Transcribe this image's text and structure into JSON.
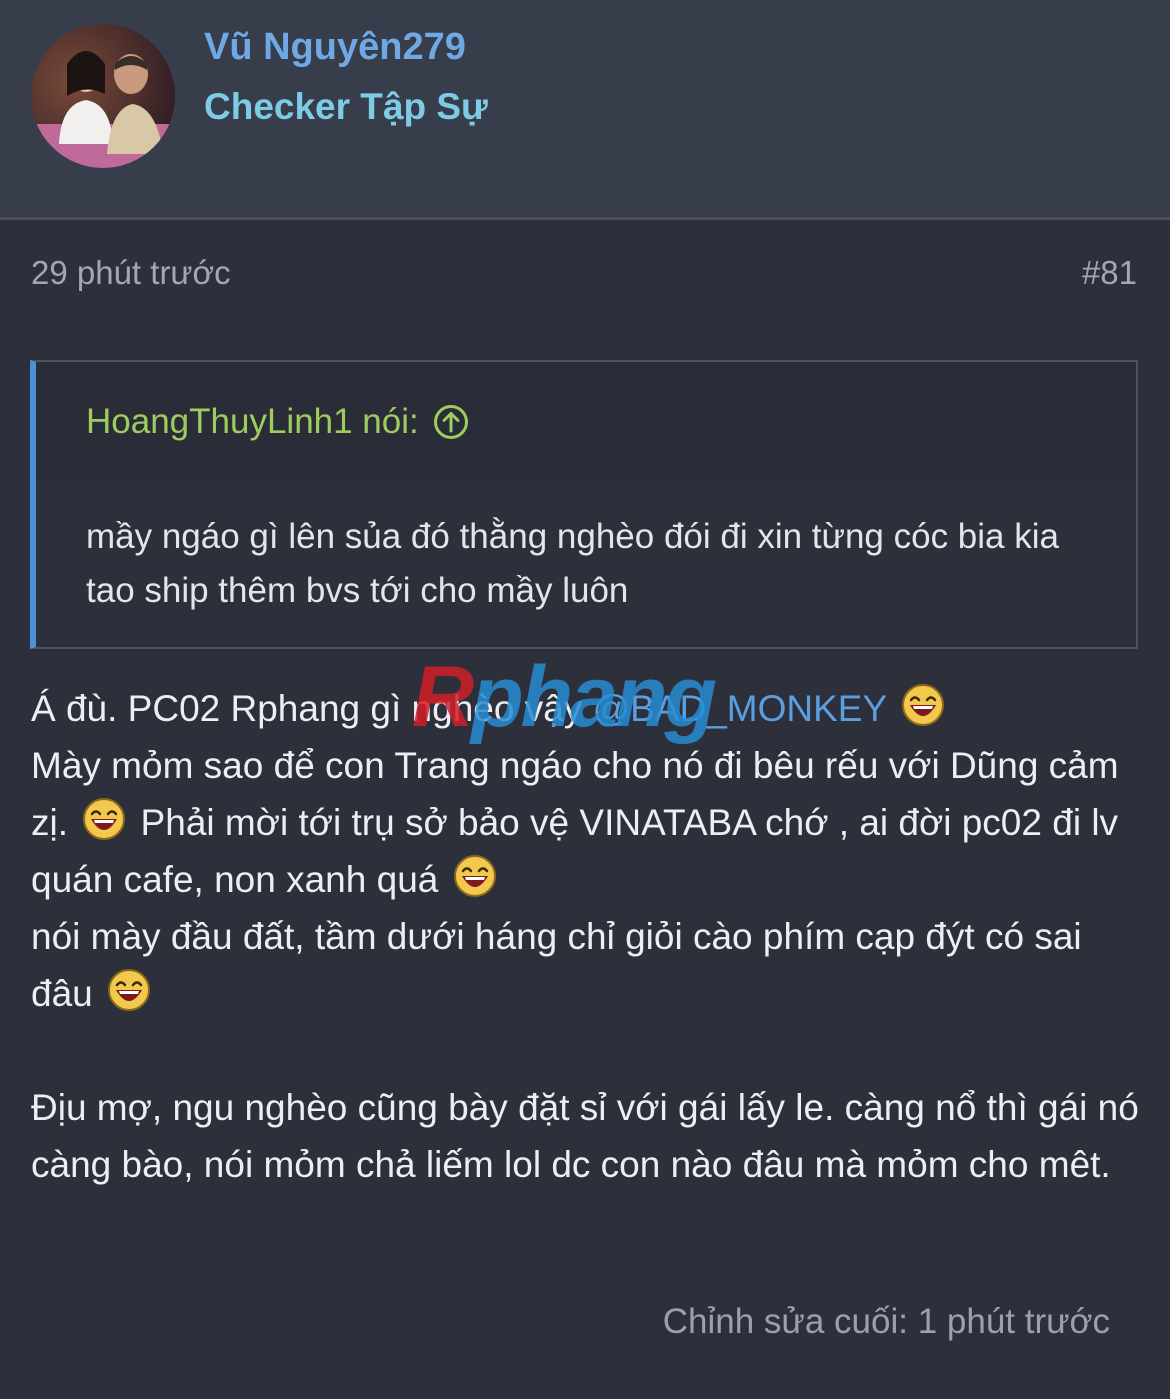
{
  "user": {
    "name": "Vũ Nguyên279",
    "title": "Checker Tập Sự"
  },
  "post": {
    "time": "29 phút trước",
    "number": "#81",
    "edited": "Chỉnh sửa cuối: 1 phút trước"
  },
  "quote": {
    "author": "HoangThuyLinh1 nói:",
    "icon": "arrow-up-circle-icon",
    "text": "mầy ngáo gì lên sủa đó thằng nghèo đói đi xin từng cóc bia kia tao ship thêm bvs tới cho mầy luôn"
  },
  "message": {
    "line1_text": "Á đù. PC02 Rphang gì nghèo vậy ",
    "mention": "@BAD_MONKEY",
    "line2_a": "Mày mỏm sao để con Trang ngáo cho nó đi bêu rếu với Dũng cảm zị. ",
    "line2_b": " Phải mời tới trụ sở bảo vệ VINATABA chớ , ai đời pc02 đi lv quán cafe, non xanh quá ",
    "line3": "nói mày đầu đất, tầm dưới háng chỉ giỏi cào phím cạp đýt có sai đâu ",
    "paragraph2": "Địu mợ, ngu nghèo cũng bày đặt sỉ với gái lấy le. càng nổ thì gái nó càng bào, nói mỏm chả liếm lol dc con nào đâu mà mỏm cho mêt."
  },
  "watermark": {
    "logo": "Rphang"
  },
  "colors": {
    "background": "#2d303b",
    "header": "#373d4b",
    "username": "#6ea9e6",
    "usertitle": "#7ecbe6",
    "quote_author": "#9ccd5e",
    "quote_bar": "#4f8fd6",
    "mention": "#5a9fe0"
  }
}
